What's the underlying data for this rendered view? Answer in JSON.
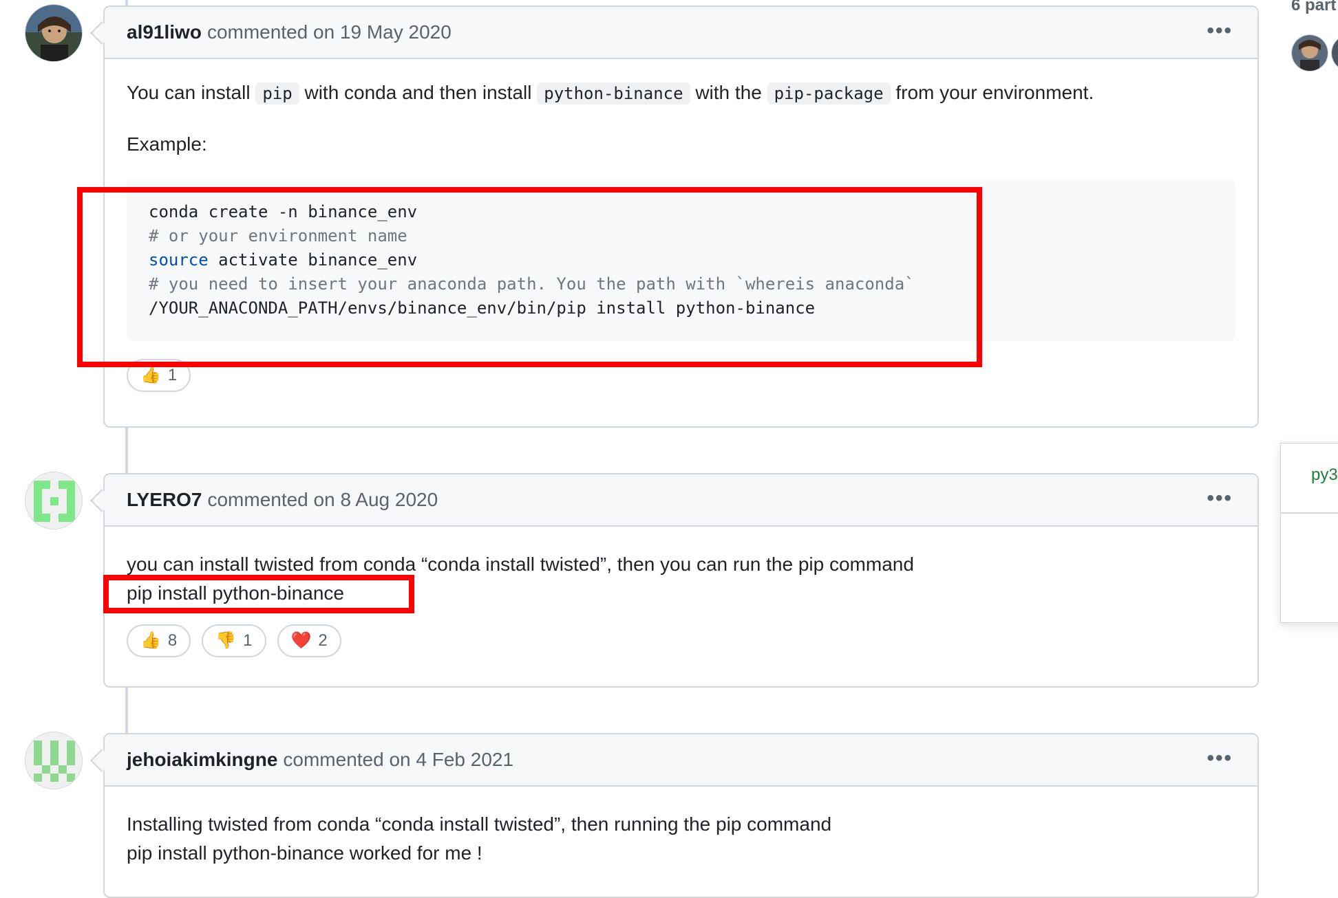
{
  "sidebar": {
    "participants_label": "6 part",
    "panel_text": "py3"
  },
  "comments": [
    {
      "author": "al91liwo",
      "action": "commented on 19 May 2020",
      "avatar_icon": "photo-avatar",
      "menu_icon": "kebab-menu-icon",
      "body": {
        "part1": "You can install",
        "code1": "pip",
        "part2": "with conda and then install",
        "code2": "python-binance",
        "part3": "with the",
        "code3": "pip-package",
        "part4": "from your environment.",
        "example_label": "Example:"
      },
      "code_lines": [
        {
          "text": "conda create -n binance_env",
          "kind": "plain"
        },
        {
          "text": "# or your environment name",
          "kind": "comment"
        },
        {
          "keyword": "source",
          "text": " activate binance_env",
          "kind": "keyword"
        },
        {
          "text": "# you need to insert your anaconda path. You the path with `whereis anaconda`",
          "kind": "comment"
        },
        {
          "text": "/YOUR_ANACONDA_PATH/envs/binance_env/bin/pip install python-binance",
          "kind": "plain"
        }
      ],
      "reactions": [
        {
          "emoji": "👍",
          "count": "1",
          "icon": "thumbs-up-icon"
        }
      ]
    },
    {
      "author": "LYERO7",
      "action": "commented on 8 Aug 2020",
      "avatar_icon": "identicon-avatar",
      "menu_icon": "kebab-menu-icon",
      "body": {
        "line1": "you can install twisted from conda “conda install twisted”, then you can run the pip command",
        "line2": "pip install python-binance"
      },
      "reactions": [
        {
          "emoji": "👍",
          "count": "8",
          "icon": "thumbs-up-icon"
        },
        {
          "emoji": "👎",
          "count": "1",
          "icon": "thumbs-down-icon"
        },
        {
          "emoji": "❤️",
          "count": "2",
          "icon": "heart-icon"
        }
      ]
    },
    {
      "author": "jehoiakimkingne",
      "action": "commented on 4 Feb 2021",
      "avatar_icon": "identicon-avatar",
      "menu_icon": "kebab-menu-icon",
      "body": {
        "line1": "Installing twisted from conda “conda install twisted”, then running the pip command",
        "line2": "pip install python-binance worked for me !"
      }
    }
  ],
  "colors": {
    "highlight": "#ff0000",
    "identicon_green": "#7ee787"
  }
}
